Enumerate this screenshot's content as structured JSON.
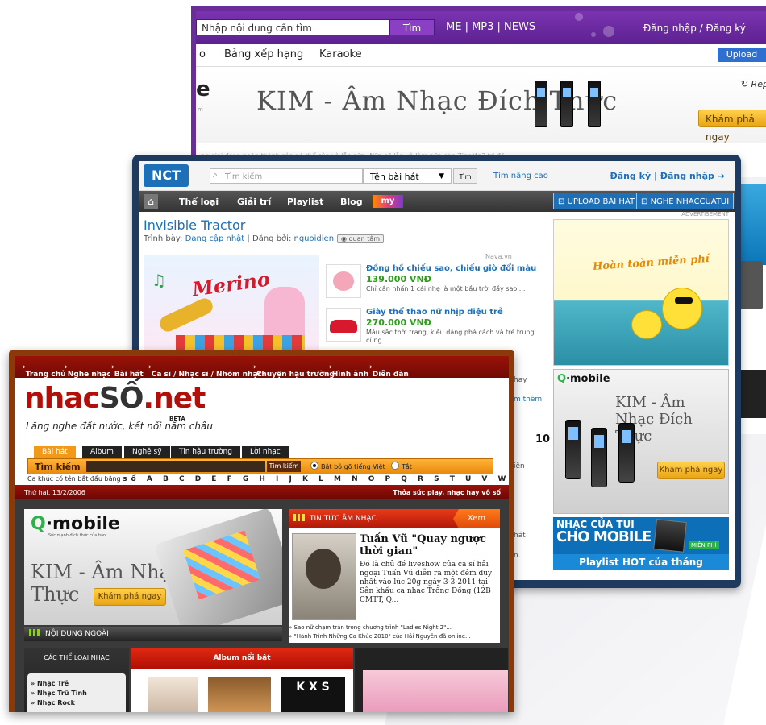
{
  "back_window": {
    "search_placeholder": "Nhập nội dung cần tìm",
    "search_button": "Tìm",
    "nav": "ME | MP3 | NEWS",
    "login": "Đăng nhập / Đăng ký",
    "menu_partial": "o",
    "menu": [
      "Bảng xếp hạng",
      "Karaoke"
    ],
    "upload": "Upload",
    "replay": "Repl",
    "banner_title": "KIM - Âm Nhạc Đích Thực",
    "banner_partial_e": "e",
    "banner_partial_m": "m",
    "banner_cta": "Khám phá ngay",
    "strip_text": "ng giai đoạn hoàn thành sản nó thể của và lẫn nữa. Nữa sẽ lẫn và làm nữa cho ZingMp3 trị đã..."
  },
  "middle_window": {
    "logo": "NCT",
    "search_placeholder": "Tìm kiếm",
    "search_type": "Tên bài hát",
    "search_button": "Tìm",
    "advanced": "Tìm nâng cao",
    "login": "Đăng ký | Đăng nhập",
    "nav": [
      "Thể loại",
      "Giải trí",
      "Playlist",
      "Blog"
    ],
    "my_label": "my",
    "upload_btn": "UPLOAD BÀI HÁT",
    "listen_btn": "NGHE NHACCUATUI",
    "advertisement": "ADVERTISEMENT",
    "title": "Invisible Tractor",
    "by_prefix": "Trình bày: ",
    "by_artist": "Đang cập nhật",
    "by_mid": " | Đăng bởi: ",
    "by_user": "nguoidien",
    "follow": "quan tâm",
    "merino_brand": "Merino",
    "merino_note": "♫",
    "nava": "Nava.vn",
    "products": [
      {
        "title": "Đồng hồ chiếu sao, chiếu giờ đổi màu",
        "price": "139.000 VNĐ",
        "desc": "Chỉ cần nhấn 1 cái nhẹ là một bầu trời đầy sao ..."
      },
      {
        "title": "Giày thể thao nữ nhịp điệu trẻ",
        "price": "270.000 VNĐ",
        "desc": "Mẫu sắc thời trang, kiểu dáng phá cách và trẻ trung cùng ..."
      }
    ],
    "side_bits": [
      "hay",
      "m thêm",
      "10",
      "iên",
      "hát",
      "n."
    ],
    "ad_free_text": "Hoàn toàn miễn phí",
    "qm_logo_q": "Q",
    "qm_logo_rest": "·mobile",
    "qm_kim": "KIM - Âm Nhạc Đích Thực",
    "qm_cta": "Khám phá ngay",
    "nm_line1": "NHẠC CỦA TUI",
    "nm_line2": "CHO MOBILE",
    "nm_free": "MIỄN PHÍ",
    "nm_hot": "Playlist HOT của tháng"
  },
  "front_window": {
    "topnav": [
      "Trang chủ",
      "Nghe nhạc",
      "Bài hát",
      "Ca sĩ / Nhạc sĩ / Nhóm nhạc",
      "Chuyện hậu trường",
      "Hình ảnh",
      "Diễn đàn"
    ],
    "logo_a": "nhac",
    "logo_b": "SỐ",
    "logo_c": ".net",
    "beta": "BETA",
    "slogan": "Lắng nghe đất nước, kết nối năm châu",
    "tabs": [
      "Bài hát",
      "Album",
      "Nghệ sỹ",
      "Tin hậu trường",
      "Lời nhạc"
    ],
    "search_label": "Tìm kiếm",
    "search_button": "Tìm kiếm",
    "radio1": "Bật bỏ gõ tiếng Việt",
    "radio2": "Tắt",
    "alpha_prefix": "Ca khúc có tên bắt đầu bằng",
    "alpha": "số A B C D E F G H I J K L M N O P Q R S T U V W X Y Z",
    "date": "Thứ hai, 13/2/2006",
    "slogan2": "Thỏa sức play, nhạc hay vô số",
    "qm_logo_q": "Q",
    "qm_logo_rest": "·mobile",
    "qm_sub": "Sức mạnh đích thực của bạn",
    "qm_kim": "KIM - Âm Nhạc Đích Thực",
    "qm_cta": "Khám phá ngay",
    "ngoai": "NỘI DUNG NGOÀI",
    "news_head": "TIN TỨC ÂM NHẠC",
    "news_more": "Xem",
    "news_title": "Tuấn Vũ \"Quay ngược thời gian\"",
    "news_text": "Đó là chủ đề liveshow của ca sĩ hải ngoại Tuấn Vũ diễn ra một đêm duy nhất vào lúc 20g ngày 3-3-2011 tại Sân khấu ca nhạc Trống Đồng (12B CMTT, Q...",
    "news_links": [
      "Sao nữ chạm trán trong chương trình \"Ladies Night 2\"...",
      "\"Hành Trình Những Ca Khúc 2010\" của Hải Nguyên đã online..."
    ],
    "cat_head": "CÁC THỂ LOẠI NHẠC",
    "cats": [
      "Nhạc Trẻ",
      "Nhạc Trữ Tình",
      "Nhạc Rock"
    ],
    "album_head": "Album nổi bật",
    "album_kxs": "K X S"
  }
}
